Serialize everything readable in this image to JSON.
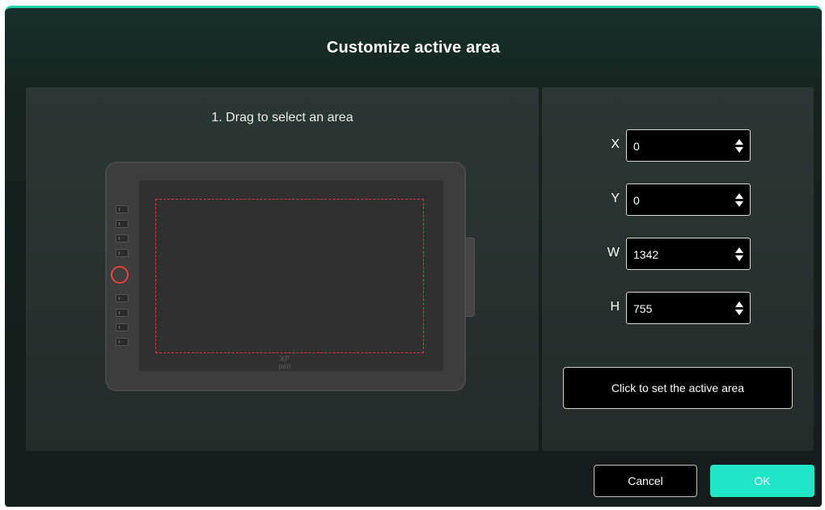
{
  "dialog": {
    "title": "Customize active area",
    "accent_color": "#1fd1b3"
  },
  "preview": {
    "instruction": "1. Drag to select an area",
    "brand_line1": "XP",
    "brand_line2": "pen",
    "active_area_color": "#e53b3b",
    "icons": [
      "tablet-illustration",
      "express-key-icon",
      "dial-ring-icon"
    ]
  },
  "fields": [
    {
      "label": "X",
      "value": "0"
    },
    {
      "label": "Y",
      "value": "0"
    },
    {
      "label": "W",
      "value": "1342"
    },
    {
      "label": "H",
      "value": "755"
    }
  ],
  "set_button": {
    "label": "Click to set the active area"
  },
  "footer": {
    "cancel_label": "Cancel",
    "ok_label": "OK",
    "ok_color": "#1ee6c6"
  }
}
